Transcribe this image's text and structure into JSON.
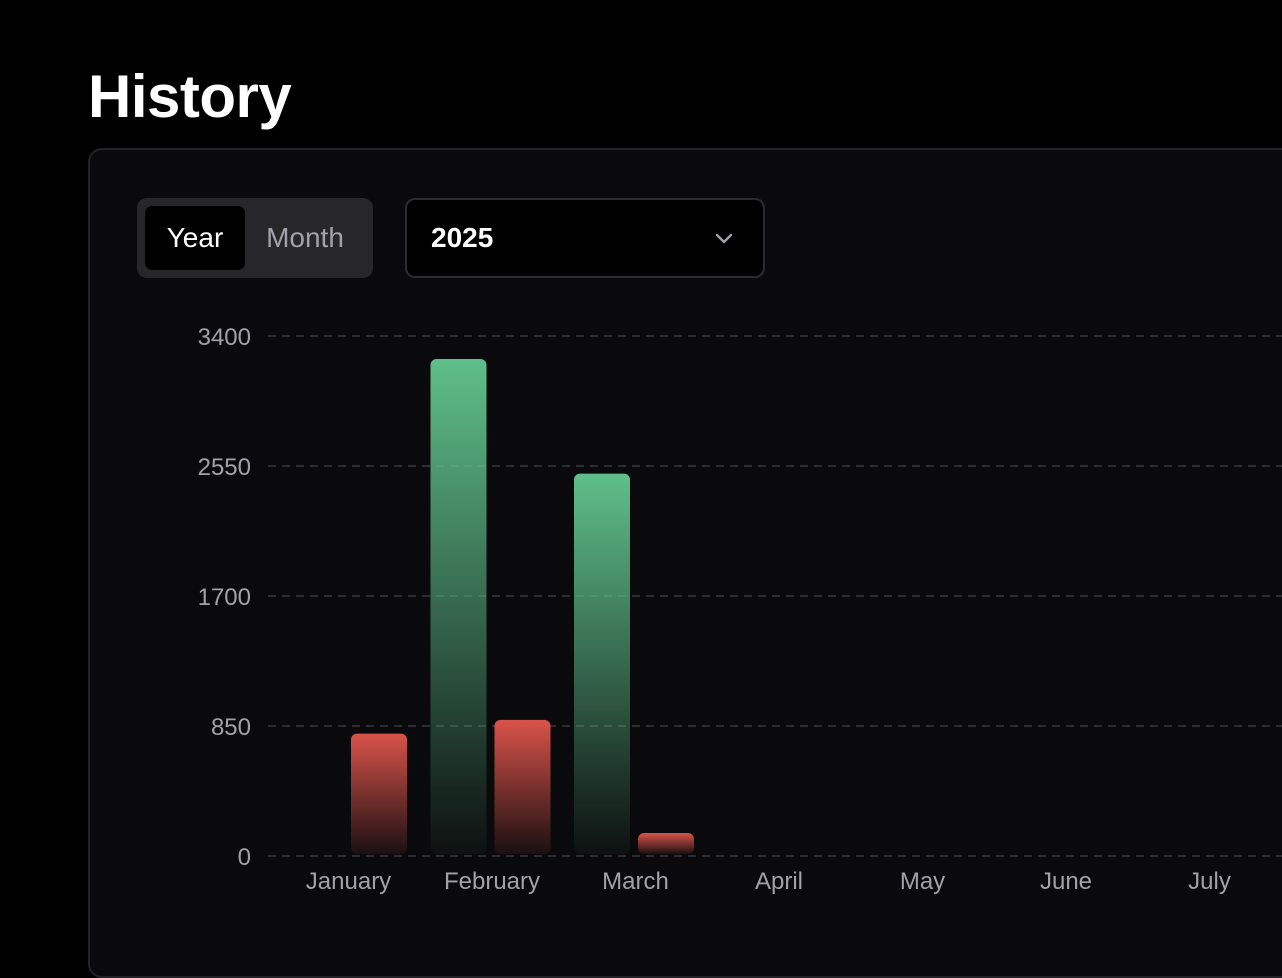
{
  "page": {
    "title": "History"
  },
  "controls": {
    "toggle": {
      "options": [
        "Year",
        "Month"
      ],
      "active": "Year"
    },
    "year_select": {
      "value": "2025"
    }
  },
  "icons": {
    "select_chevron": "chevron-down-icon"
  },
  "colors": {
    "income": "#5fbf8a",
    "expense": "#d9534a",
    "grid": "#3a3a3e",
    "tick_label": "#a1a1aa"
  },
  "chart_data": {
    "type": "bar",
    "categories": [
      "January",
      "February",
      "March",
      "April",
      "May",
      "June",
      "July"
    ],
    "series": [
      {
        "color": "#5fbf8a",
        "values": [
          0,
          3250,
          2500,
          0,
          0,
          0,
          0
        ]
      },
      {
        "color": "#d9534a",
        "values": [
          800,
          890,
          150,
          0,
          0,
          0,
          0
        ]
      }
    ],
    "yticks": [
      0,
      850,
      1700,
      2550,
      3400
    ],
    "ylim": [
      0,
      3400
    ],
    "grid": true,
    "grid_style": "dashed"
  }
}
